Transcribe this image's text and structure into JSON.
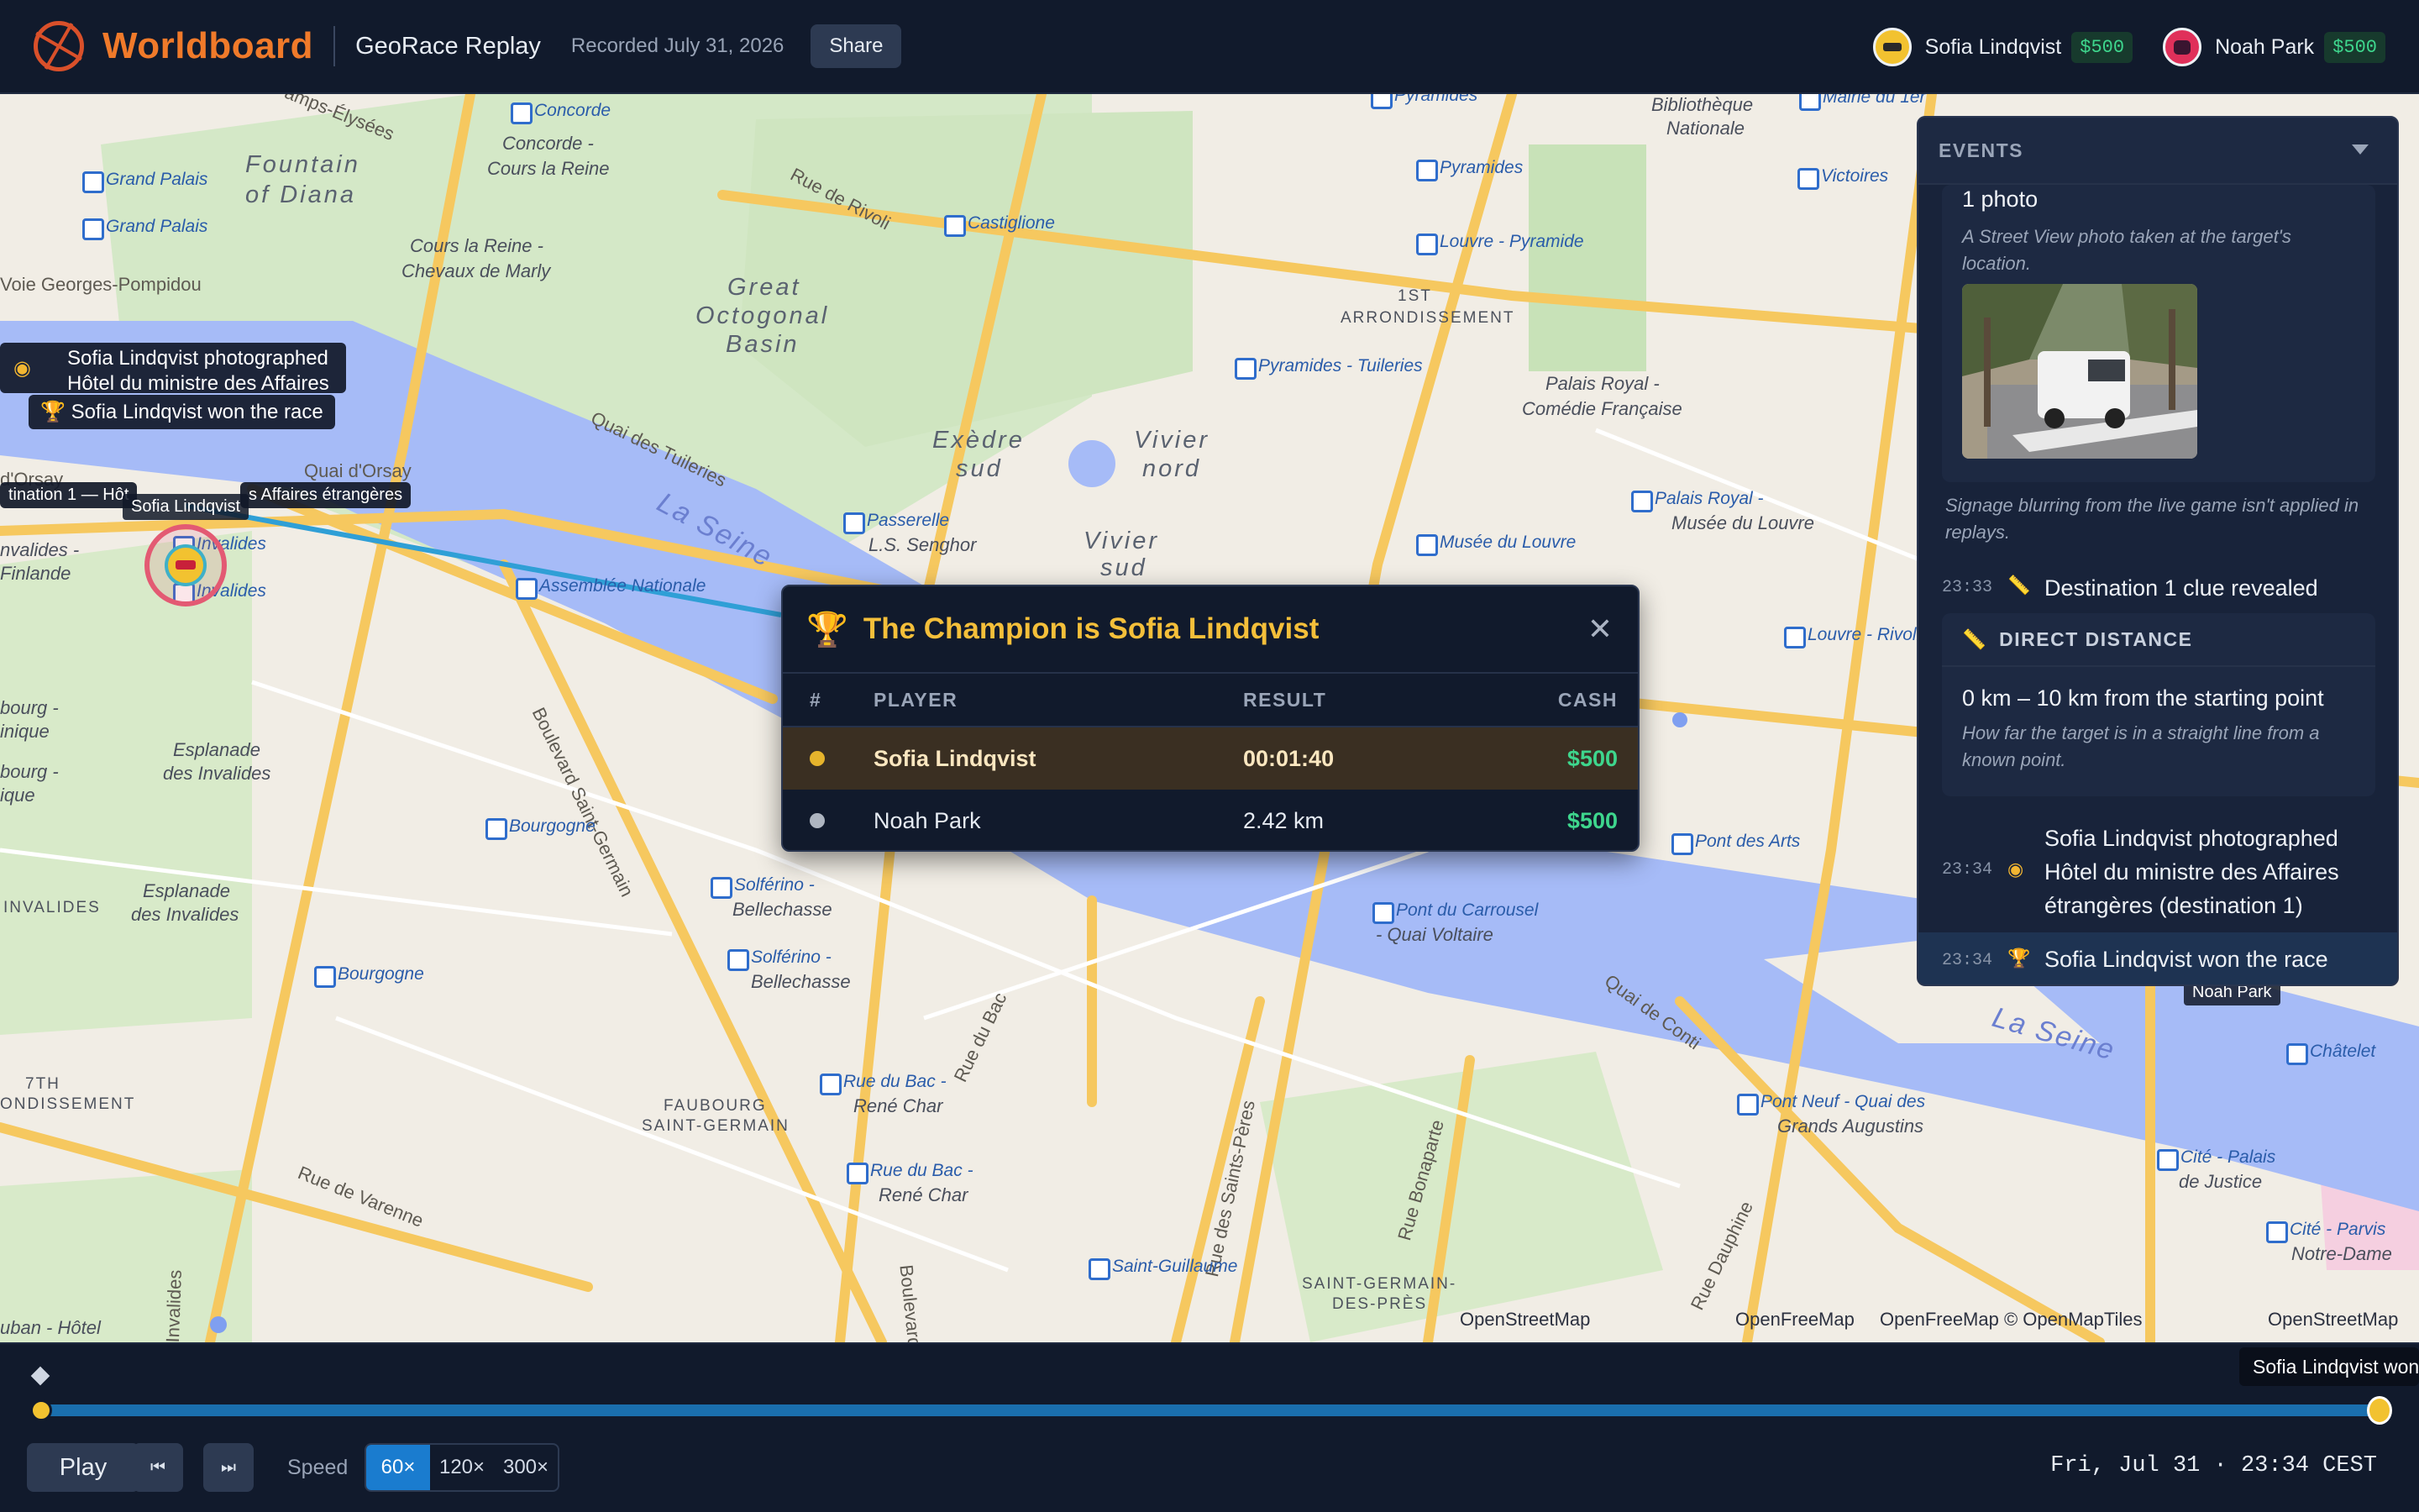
{
  "header": {
    "brand": "Worldboard",
    "subtitle": "GeoRace Replay",
    "recorded": "Recorded July 31, 2026",
    "share_label": "Share",
    "players": [
      {
        "name": "Sofia Lindqvist",
        "cash": "$500"
      },
      {
        "name": "Noah Park",
        "cash": "$500"
      }
    ]
  },
  "map": {
    "labels": {
      "champs": "amps-Élysées",
      "concorde": "Concorde",
      "concorde_cours": "Concorde -",
      "cours_reine1": "Cours la Reine",
      "fountain": "Fountain",
      "of_diana": "of Diana",
      "grand_palais1": "Grand Palais",
      "grand_palais2": "Grand Palais",
      "cours_reine2": "Cours la Reine -",
      "chevaux": "Chevaux de Marly",
      "voie": "Voie Georges-Pompidou",
      "rue_rivoli": "Rue de Rivoli",
      "castiglione": "Castiglione",
      "great": "Great",
      "octogonal": "Octogonal",
      "basin": "Basin",
      "pyramides_top": "Pyramides",
      "pyramides": "Pyramides",
      "louvre_pyr": "Louvre - Pyramide",
      "arr1a": "1ST",
      "arr1b": "ARRONDISSEMENT",
      "bibliotheque": "Bibliothèque",
      "nationale": "Nationale",
      "mairie": "Mairie du 1er",
      "victoires": "Victoires",
      "pyr_tuileries": "Pyramides - Tuileries",
      "palais_royal1": "Palais Royal -",
      "comedie": "Comédie Française",
      "exedre1": "Exèdre",
      "exedre2": "sud",
      "vivier_nord1": "Vivier",
      "vivier_nord2": "nord",
      "quai_tuileries": "Quai des Tuileries",
      "quai_orsay": "Quai d'Orsay",
      "orsay": "d'Orsay",
      "la_seine1": "La Seine",
      "passerelle": "Passerelle",
      "senghor": "L.S. Senghor",
      "vivier_sud1": "Vivier",
      "vivier_sud2": "sud",
      "palais_royal2": "Palais Royal -",
      "musee_louvre1": "Musée du Louvre",
      "musee_louvre2": "Musée du Louvre",
      "invalides1": "Invalides",
      "invalides2": "Invalides",
      "invalides_fin1": "nvalides -",
      "invalides_fin2": "Finlande",
      "assemblee": "Assemblée Nationale",
      "louvre_rivoli": "Louvre - Rivoli",
      "bd_st_germain": "Boulevard Saint-Germain",
      "bourg1": "bourg -",
      "bourg2": "inique",
      "bourg3": "bourg -",
      "bourg4": "ique",
      "esplanade1": "Esplanade",
      "esplanade2": "des Invalides",
      "bourgogne1": "Bourgogne",
      "pont_arts": "Pont des Arts",
      "esplanade3": "Esplanade",
      "esplanade4": "des Invalides",
      "invalides_caps": "INVALIDES",
      "solferino1": "Solférino -",
      "solferino2": "Bellechasse",
      "solferino3": "Solférino -",
      "solferino4": "Bellechasse",
      "bourgogne2": "Bourgogne",
      "pont_carrousel1": "Pont du Carrousel",
      "pont_carrousel2": "- Quai Voltaire",
      "quai_conti": "Quai de Conti",
      "la_seine2": "La Seine",
      "chatelet": "Châtelet",
      "rue_bac": "Rue du Bac",
      "arr7a": "7TH",
      "arr7b": "ONDISSEMENT",
      "faubourg1": "FAUBOURG",
      "faubourg2": "SAINT-GERMAIN",
      "bac_rene1": "Rue du Bac -",
      "bac_rene2": "René Char",
      "bac_rene3": "Rue du Bac -",
      "bac_rene4": "René Char",
      "pont_neuf1": "Pont Neuf - Quai des",
      "pont_neuf2": "Grands Augustins",
      "cite_palais1": "Cité - Palais",
      "cite_palais2": "de Justice",
      "rue_varenne": "Rue de Varenne",
      "rue_sts_peres": "Rue des Saints-Pères",
      "rue_bonaparte": "Rue Bonaparte",
      "rue_dauphine": "Rue Dauphine",
      "cite_parvis1": "Cité - Parvis",
      "cite_parvis2": "Notre-Dame",
      "st_guillaume": "Saint-Guillaume",
      "st_germain_pres1": "SAINT-GERMAIN-",
      "st_germain_pres2": "DES-PRÈS",
      "boulevard": "Boulevard",
      "invalides_v": "Invalides",
      "hotel": "uban - Hôtel"
    },
    "attribution": [
      "OpenStreetMap",
      "OpenFreeMap",
      "OpenFreeMap © OpenMapTiles",
      "OpenStreetMap"
    ],
    "bubble_photo_line1": "Sofia Lindqvist photographed",
    "bubble_photo_line2": "Hôtel du ministre des Affaires",
    "bubble_won": "Sofia Lindqvist won the race",
    "destination_label_left": "tination 1 — Hôt",
    "destination_label_right": "s Affaires étrangères",
    "pin_label": "Sofia Lindqvist",
    "noah_pin_label": "Noah Park"
  },
  "champion": {
    "title": "The Champion is Sofia Lindqvist",
    "columns": [
      "#",
      "PLAYER",
      "RESULT",
      "CASH"
    ],
    "rows": [
      {
        "player": "Sofia Lindqvist",
        "result": "00:01:40",
        "cash": "$500"
      },
      {
        "player": "Noah Park",
        "result": "2.42 km",
        "cash": "$500"
      }
    ]
  },
  "events": {
    "header": "EVENTS",
    "photo_card_title": "1 photo",
    "photo_card_note": "A Street View photo taken at the target's location.",
    "replay_note": "Signage blurring from the live game isn't applied in replays.",
    "items": [
      {
        "time": "23:33",
        "text": "Destination 1 clue revealed"
      },
      {
        "time": "23:34",
        "text": "Sofia Lindqvist photographed Hôtel du ministre des Affaires étrangères (destination 1)"
      },
      {
        "time": "23:34",
        "text": "Sofia Lindqvist won the race"
      }
    ],
    "clue_title": "DIRECT DISTANCE",
    "clue_value": "0 km – 10 km from the starting point",
    "clue_note": "How far the target is in a straight line from a known point."
  },
  "playback": {
    "play_label": "Play",
    "speed_label": "Speed",
    "speeds": [
      "60×",
      "120×",
      "300×"
    ],
    "active_speed": "60×",
    "tooltip": "Sofia Lindqvist won the race",
    "progress": 1.0,
    "clock": "Fri, Jul 31 · 23:34 CEST"
  }
}
